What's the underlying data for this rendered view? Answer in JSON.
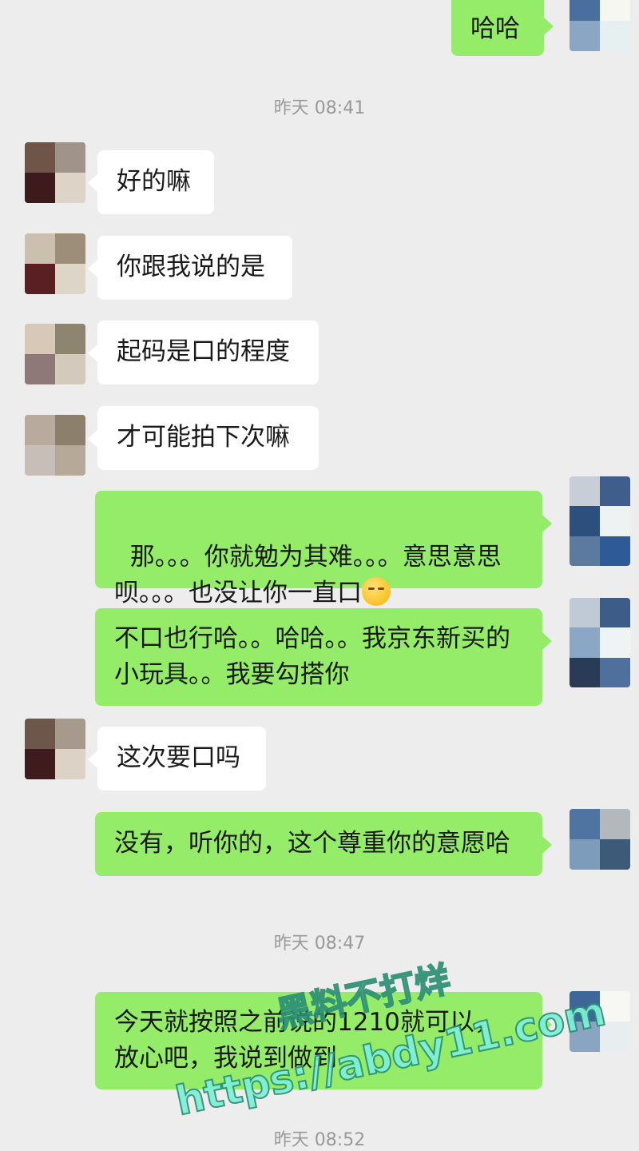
{
  "timestamps": [
    "昨天 08:41",
    "昨天 08:47",
    "昨天 08:52"
  ],
  "messages": [
    {
      "side": "out",
      "text": "哈哈"
    },
    {
      "side": "in",
      "text": "好的嘛"
    },
    {
      "side": "in",
      "text": "你跟我说的是"
    },
    {
      "side": "in",
      "text": "起码是口的程度"
    },
    {
      "side": "in",
      "text": "才可能拍下次嘛"
    },
    {
      "side": "out",
      "text": "那。。。你就勉为其难。。。意思意思呗。。。也没让你一直口",
      "emoji": "shushing-face-emoji"
    },
    {
      "side": "out",
      "text": "不口也行哈。。哈哈。。我京东新买的小玩具。。我要勾搭你"
    },
    {
      "side": "in",
      "text": "这次要口吗"
    },
    {
      "side": "out",
      "text": "没有，听你的，这个尊重你的意愿哈"
    },
    {
      "side": "out",
      "text": "今天就按照之前说的1210就可以，放心吧，我说到做到"
    }
  ],
  "watermark": {
    "line1": "黑料不打烊",
    "line2": "https://abdy11.com"
  },
  "colors": {
    "background": "#ededed",
    "incoming_bubble": "#ffffff",
    "outgoing_bubble": "#95ec69",
    "timestamp": "#999999"
  }
}
